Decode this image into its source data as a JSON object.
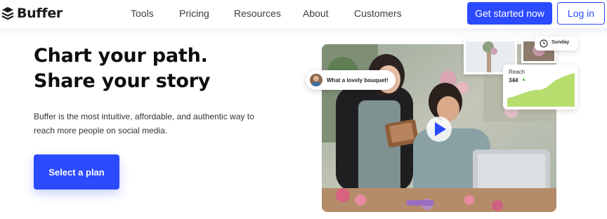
{
  "brand": {
    "name": "Buffer",
    "icon": "buffer-stack-icon"
  },
  "nav": {
    "links": [
      "Tools",
      "Pricing",
      "Resources",
      "About",
      "Customers"
    ],
    "get_started": "Get started now",
    "login": "Log in"
  },
  "hero": {
    "headline_line1": "Chart your path.",
    "headline_line2": "Share your story",
    "subtext": "Buffer is the most intuitive, affordable, and authentic way to reach more people on social media.",
    "cta": "Select a plan"
  },
  "media": {
    "comment": "What a lovely bouquet!",
    "reach_label": "Reach",
    "reach_value": "344",
    "reach_trend_icon": "up-arrow-icon",
    "schedule_label": "Sunday",
    "play_icon": "play-icon"
  },
  "colors": {
    "accent": "#2c4bff",
    "reach_fill": "#b6dd6e"
  }
}
